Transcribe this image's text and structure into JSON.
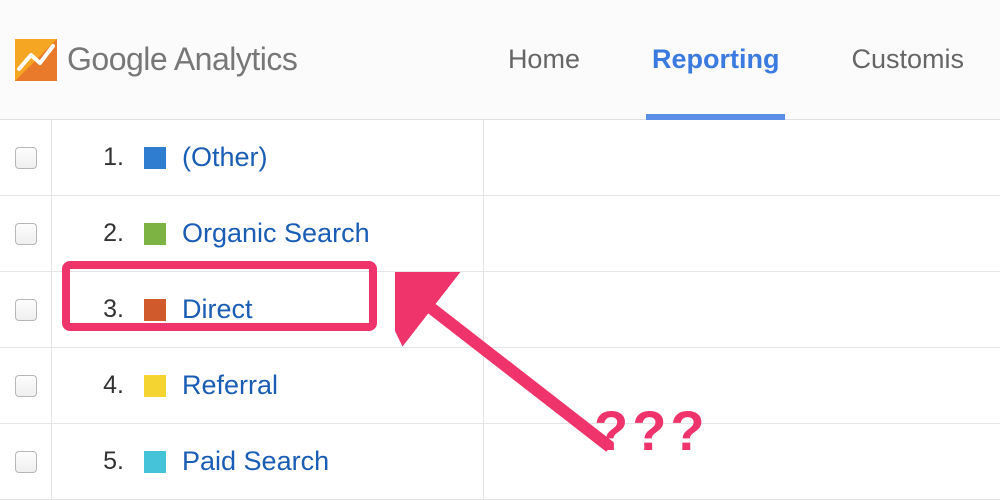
{
  "brand": {
    "name_bold": "Google",
    "name_light": "Analytics"
  },
  "nav": {
    "items": [
      {
        "label": "Home",
        "active": false
      },
      {
        "label": "Reporting",
        "active": true
      },
      {
        "label": "Customis",
        "active": false
      }
    ]
  },
  "table": {
    "rows": [
      {
        "index": "1.",
        "label": "(Other)",
        "swatch": "#2f7dd1"
      },
      {
        "index": "2.",
        "label": "Organic Search",
        "swatch": "#7cb342"
      },
      {
        "index": "3.",
        "label": "Direct",
        "swatch": "#d15a2c"
      },
      {
        "index": "4.",
        "label": "Referral",
        "swatch": "#f3d430"
      },
      {
        "index": "5.",
        "label": "Paid Search",
        "swatch": "#45c3d9"
      }
    ]
  },
  "annotation": {
    "text": "???",
    "color": "#ef336b"
  }
}
